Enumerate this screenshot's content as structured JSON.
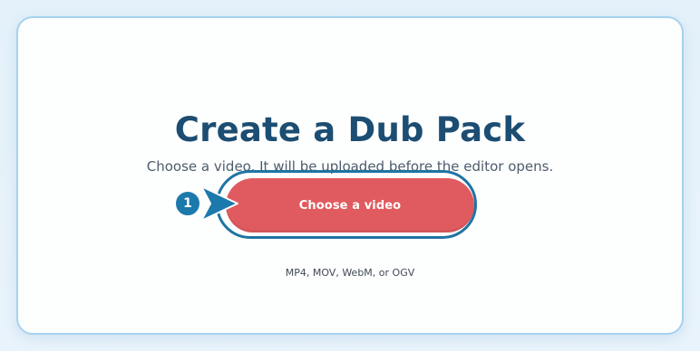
{
  "card": {
    "title": "Create a Dub Pack",
    "subtitle": "Choose a video. It will be uploaded before the editor opens.",
    "choose_button_label": "Choose a video",
    "formats_hint": "MP4, MOV, WebM, or OGV"
  },
  "step_marker": {
    "number": "1",
    "icon": "arrow-right-icon",
    "color": "#1c79ab"
  },
  "colors": {
    "accent_button": "#e05b5f",
    "title": "#1c4d72",
    "card_border": "#a6d2ee",
    "highlight_ring": "#1e74a3"
  }
}
